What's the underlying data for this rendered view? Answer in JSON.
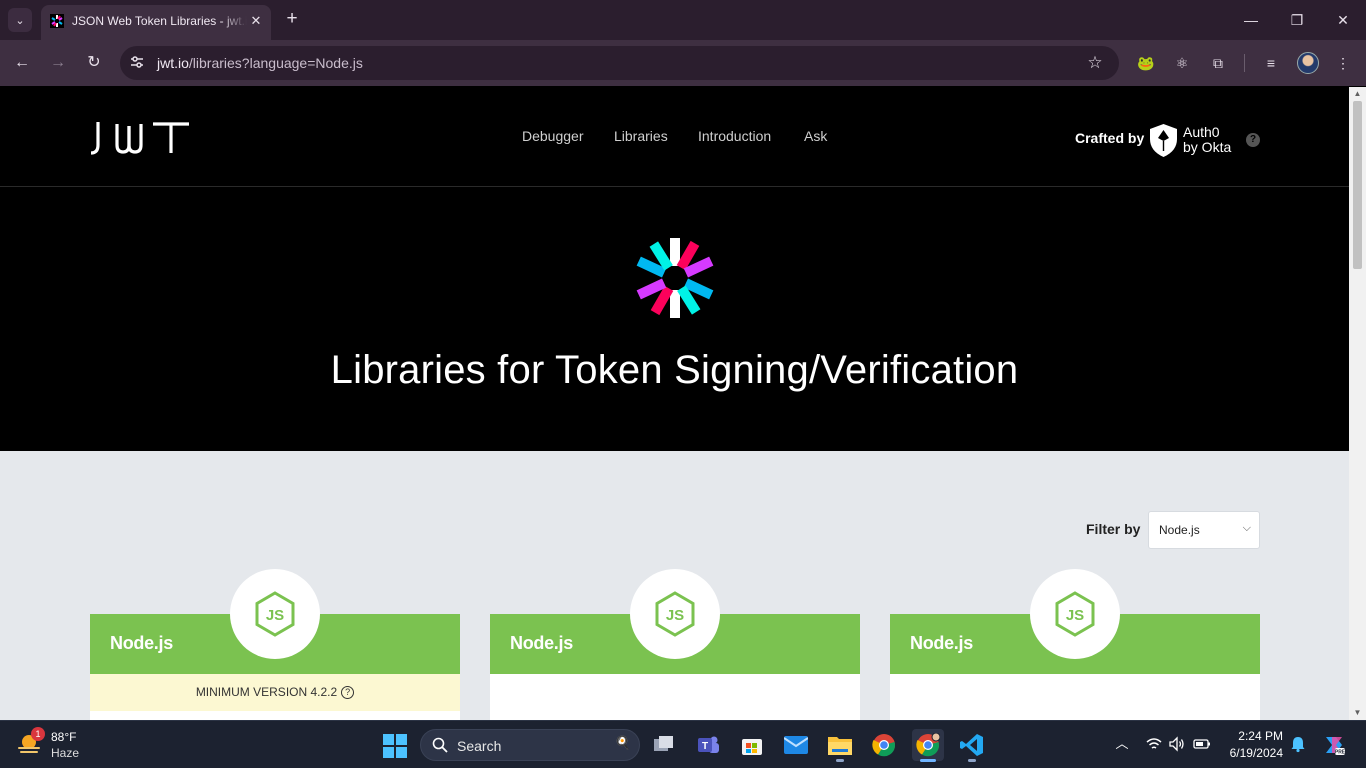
{
  "browser": {
    "tab_title": "JSON Web Token Libraries - jwt.io",
    "url_host": "jwt.io",
    "url_rest": "/libraries?language=Node.js",
    "tab_close": "✕",
    "new_tab": "+",
    "minimize": "—",
    "maximize": "❐",
    "close": "✕",
    "back": "←",
    "forward": "→",
    "reload": "↻",
    "star": "☆",
    "tab_list": "⌄",
    "site_info": "⚙",
    "extensions": [
      {
        "name": "frog-extension-icon",
        "glyph": "🐸"
      },
      {
        "name": "react-devtools-icon",
        "glyph": "⚛"
      },
      {
        "name": "extensions-puzzle-icon",
        "glyph": "⧉"
      },
      {
        "name": "media-controls-icon",
        "glyph": "≡"
      }
    ],
    "menu": "⋮"
  },
  "site": {
    "logo_text": "JWT",
    "nav": [
      "Debugger",
      "Libraries",
      "Introduction",
      "Ask"
    ],
    "crafted_by": "Crafted by",
    "auth0_line1": "Auth0",
    "auth0_line2": "by Okta",
    "help": "?"
  },
  "hero": {
    "title": "Libraries for Token Signing/Verification"
  },
  "filter": {
    "label": "Filter by",
    "selected": "Node.js"
  },
  "cards": [
    {
      "name": "Node.js",
      "min_version": "MINIMUM VERSION 4.2.2"
    },
    {
      "name": "Node.js",
      "min_version": ""
    },
    {
      "name": "Node.js",
      "min_version": ""
    }
  ],
  "taskbar": {
    "weather_temp": "88°F",
    "weather_desc": "Haze",
    "weather_badge": "1",
    "search_label": "Search",
    "time": "2:24 PM",
    "date": "6/19/2024"
  },
  "colors": {
    "node_green": "#7bc250",
    "min_version_bg": "#fcf8d2",
    "content_bg": "#e5e8ec"
  }
}
